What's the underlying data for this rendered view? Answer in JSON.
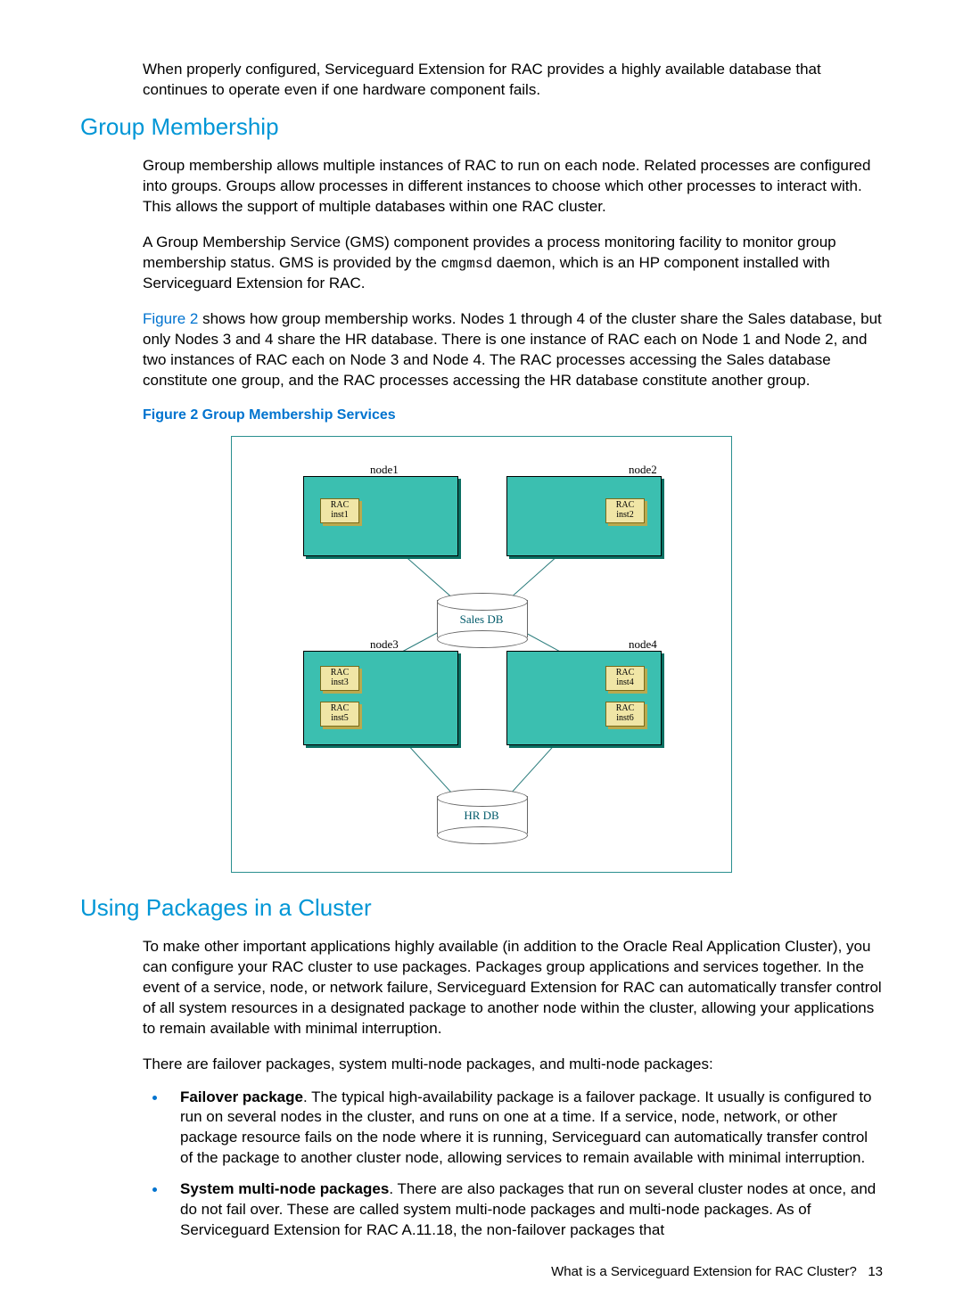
{
  "intro_para": "When properly configured, Serviceguard Extension for RAC provides a highly available database that continues to operate even if one hardware component fails.",
  "section1": {
    "heading": "Group Membership",
    "para1": "Group membership allows multiple instances of RAC to run on each node. Related processes are configured into groups. Groups allow processes in different instances to choose which other processes to interact with. This allows the support of multiple databases within one RAC cluster.",
    "para2a": "A Group Membership Service (GMS) component provides a process monitoring facility to monitor group membership status. GMS is provided by the ",
    "para2_code": "cmgmsd",
    "para2b": " daemon, which is an HP component installed with Serviceguard Extension for RAC.",
    "para3_link": "Figure 2",
    "para3a": " shows how group membership works. Nodes 1 through 4 of the cluster share the Sales database, but only Nodes 3 and 4 share the HR database. There is one instance of RAC each on Node 1 and Node 2, and two instances of RAC each on Node 3 and Node 4. The RAC processes accessing the Sales database constitute one group, and the RAC processes accessing the HR database constitute another group."
  },
  "figure": {
    "caption": "Figure 2 Group Membership Services",
    "node1_label": "node1",
    "node2_label": "node2",
    "node3_label": "node3",
    "node4_label": "node4",
    "rac1": "RAC\ninst1",
    "rac2": "RAC\ninst2",
    "rac3": "RAC\ninst3",
    "rac4": "RAC\ninst4",
    "rac5": "RAC\ninst5",
    "rac6": "RAC\ninst6",
    "sales_db": "Sales DB",
    "hr_db": "HR DB"
  },
  "section2": {
    "heading": "Using Packages in a Cluster",
    "para1": "To make other important applications highly available (in addition to the Oracle Real Application Cluster), you can configure your RAC cluster to use packages. Packages group applications and services together. In the event of a service, node, or network failure, Serviceguard Extension for RAC can automatically transfer control of all system resources in a designated package to another node within the cluster, allowing your applications to remain available with minimal interruption.",
    "para2": "There are failover packages, system multi-node packages, and multi-node packages:",
    "bullets": [
      {
        "term": "Failover package",
        "text": ". The typical high-availability package is a failover package. It usually is configured to run on several nodes in the cluster, and runs on one at a time. If a service, node, network, or other package resource fails on the node where it is running, Serviceguard can automatically transfer control of the package to another cluster node, allowing services to remain available with minimal interruption."
      },
      {
        "term": "System multi-node packages",
        "text": ". There are also packages that run on several cluster nodes at once, and do not fail over. These are called system multi-node packages and multi-node packages. As of Serviceguard Extension for RAC A.11.18, the non-failover packages that"
      }
    ]
  },
  "footer": {
    "text": "What is a Serviceguard Extension for RAC Cluster?",
    "page_num": "13"
  }
}
